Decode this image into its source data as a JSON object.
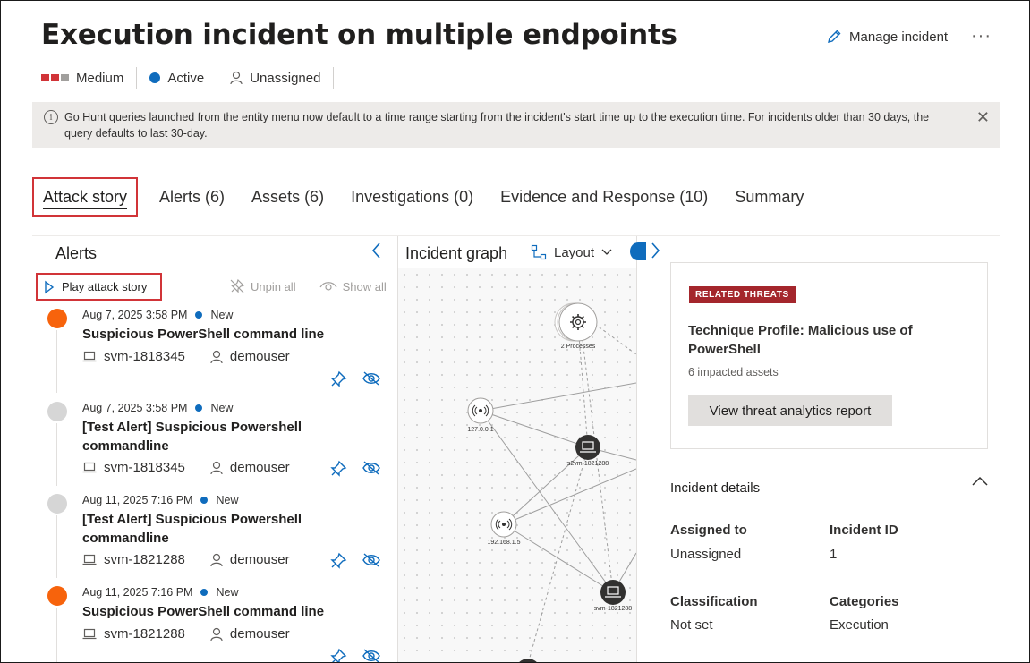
{
  "incident": {
    "title": "Execution incident on multiple endpoints",
    "manage_label": "Manage incident",
    "more_label": "···",
    "severity": "Medium",
    "status": "Active",
    "assignee": "Unassigned"
  },
  "banner": {
    "text": "Go Hunt queries launched from the entity menu now default to a time range starting from the incident's start time up to the execution time. For incidents older than 30 days, the query defaults to last 30-day.",
    "info_glyph": "i",
    "close_glyph": "✕"
  },
  "tabs": [
    {
      "label": "Attack story",
      "active": true
    },
    {
      "label": "Alerts (6)"
    },
    {
      "label": "Assets (6)"
    },
    {
      "label": "Investigations (0)"
    },
    {
      "label": "Evidence and Response (10)"
    },
    {
      "label": "Summary"
    }
  ],
  "alerts_panel": {
    "title": "Alerts",
    "play_label": "Play attack story",
    "unpin_label": "Unpin all",
    "show_label": "Show all",
    "items": [
      {
        "date": "Aug 7, 2025 3:58 PM",
        "status": "New",
        "title": "Suspicious PowerShell command line",
        "device": "svm-1818345",
        "user": "demouser",
        "severity_color": "#f7630c"
      },
      {
        "date": "Aug 7, 2025 3:58 PM",
        "status": "New",
        "title": "[Test Alert] Suspicious Powershell commandline",
        "device": "svm-1818345",
        "user": "demouser",
        "severity_color": "#d6d6d6"
      },
      {
        "date": "Aug 11, 2025 7:16 PM",
        "status": "New",
        "title": "[Test Alert] Suspicious Powershell commandline",
        "device": "svm-1821288",
        "user": "demouser",
        "severity_color": "#d6d6d6"
      },
      {
        "date": "Aug 11, 2025 7:16 PM",
        "status": "New",
        "title": "Suspicious PowerShell command line",
        "device": "svm-1821288",
        "user": "demouser",
        "severity_color": "#f7630c"
      }
    ]
  },
  "graph": {
    "title": "Incident graph",
    "layout_label": "Layout",
    "nodes": {
      "processes": "2 Processes",
      "ip_local": "127.0.0.1",
      "device_a": "s2vm-1821288",
      "ip_lan": "192.168.1.5",
      "device_b": "svm-1821288"
    }
  },
  "threat_card": {
    "badge": "RELATED THREATS",
    "title": "Technique Profile: Malicious use of PowerShell",
    "impacted": "6 impacted assets",
    "button": "View threat analytics report"
  },
  "details": {
    "title": "Incident details",
    "assigned_label": "Assigned to",
    "assigned_value": "Unassigned",
    "id_label": "Incident ID",
    "id_value": "1",
    "classification_label": "Classification",
    "classification_value": "Not set",
    "categories_label": "Categories",
    "categories_value": "Execution"
  },
  "colors": {
    "accent": "#0f6cbd",
    "severity_high": "#d13438",
    "severity_medium": "#f7630c",
    "highlight_border": "#d13438",
    "badge": "#a4262c"
  }
}
